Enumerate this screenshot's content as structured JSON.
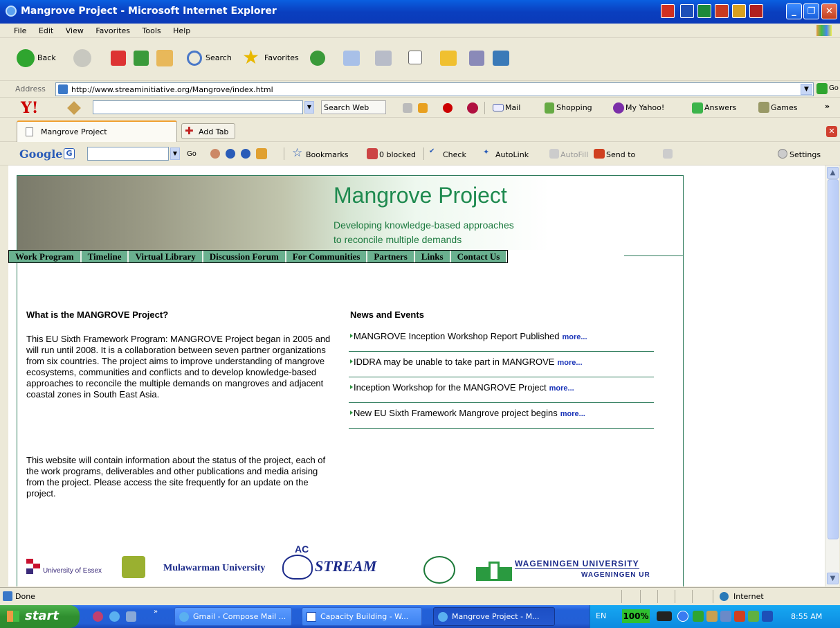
{
  "window": {
    "title": "Mangrove Project - Microsoft Internet Explorer"
  },
  "menu": [
    "File",
    "Edit",
    "View",
    "Favorites",
    "Tools",
    "Help"
  ],
  "toolbar": {
    "back": "Back",
    "search": "Search",
    "favorites": "Favorites"
  },
  "address": {
    "label": "Address",
    "url": "http://www.streaminitiative.org/Mangrove/index.html",
    "go": "Go"
  },
  "yahoo": {
    "search_web": "Search Web",
    "mail": "Mail",
    "shopping": "Shopping",
    "myyahoo": "My Yahoo!",
    "answers": "Answers",
    "games": "Games",
    "more": "»"
  },
  "tabs": {
    "tab1": "Mangrove Project",
    "add": "Add Tab"
  },
  "google": {
    "go": "Go",
    "bookmarks": "Bookmarks",
    "blocked": "0 blocked",
    "check": "Check",
    "autolink": "AutoLink",
    "autofill": "AutoFill",
    "sendto": "Send to",
    "settings": "Settings"
  },
  "page": {
    "title": "Mangrove Project",
    "subtitle1": "Developing knowledge-based approaches",
    "subtitle2": "to reconcile multiple demands",
    "nav": [
      "Work Program",
      "Timeline",
      "Virtual Library",
      "Discussion Forum",
      "For Communities",
      "Partners",
      "Links",
      "Contact Us"
    ],
    "what_heading": "What is the MANGROVE Project?",
    "what_p1": "This EU Sixth Framework Program: MANGROVE Project began in 2005 and will run until 2008. It is a collaboration between seven partner organizations from six countries. The project aims to improve understanding of mangrove ecosystems, communities and conflicts and to develop knowledge-based approaches to reconcile the multiple demands on mangroves and adjacent coastal zones in South East Asia.",
    "what_p2": "This website will contain information about the status of the project, each of the work programs,  deliverables and other publications and media arising from the project. Please access the site frequently for an update on the project.",
    "news_heading": "News and Events",
    "news": [
      {
        "text": "MANGROVE Inception Workshop Report Published",
        "more": "more..."
      },
      {
        "text": "IDDRA may be unable to take part in MANGROVE",
        "more": "more..."
      },
      {
        "text": "Inception Workshop for the MANGROVE Project",
        "more": "more..."
      },
      {
        "text": "New EU Sixth Framework Mangrove project begins",
        "more": "more..."
      }
    ],
    "logos": {
      "essex": "University of Essex",
      "mulawarman": "Mulawarman University",
      "stream": "STREAM",
      "ac": "AC",
      "wageningen": "WAGENINGEN UNIVERSITY",
      "wageningen_ur": "WAGENINGEN UR"
    }
  },
  "status": {
    "text": "Done",
    "zone": "Internet"
  },
  "taskbar": {
    "start": "start",
    "items": [
      "Gmail - Compose Mail ...",
      "Capacity Building - W...",
      "Mangrove Project - M..."
    ],
    "lang": "EN",
    "percent": "100%",
    "time": "8:55 AM"
  },
  "colors": {
    "brand_green": "#1e8a4f",
    "nav_green": "#6ab08f",
    "link_blue": "#1a34b8"
  }
}
